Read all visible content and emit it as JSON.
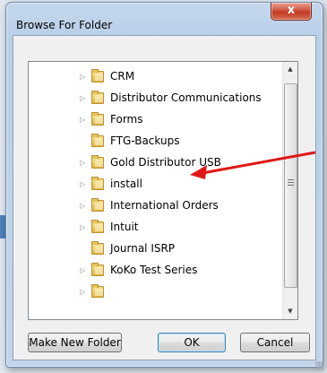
{
  "window": {
    "title": "Browse For Folder",
    "close_glyph": "x"
  },
  "tree": {
    "items": [
      {
        "label": "CRM",
        "expandable": true
      },
      {
        "label": "Distributor Communications",
        "expandable": true
      },
      {
        "label": "Forms",
        "expandable": true
      },
      {
        "label": "FTG-Backups",
        "expandable": false
      },
      {
        "label": "Gold Distributor USB",
        "expandable": true
      },
      {
        "label": "install",
        "expandable": true
      },
      {
        "label": "International Orders",
        "expandable": true
      },
      {
        "label": "Intuit",
        "expandable": true
      },
      {
        "label": "Journal ISRP",
        "expandable": false
      },
      {
        "label": "KoKo Test Series",
        "expandable": true
      }
    ],
    "scroll": {
      "up_glyph": "▲",
      "down_glyph": "▼"
    }
  },
  "buttons": {
    "new_folder": "Make New Folder",
    "ok": "OK",
    "cancel": "Cancel"
  },
  "colors": {
    "callout_arrow": "#e01818",
    "window_frame": "#b9cfe8",
    "close_button": "#c8452f"
  }
}
